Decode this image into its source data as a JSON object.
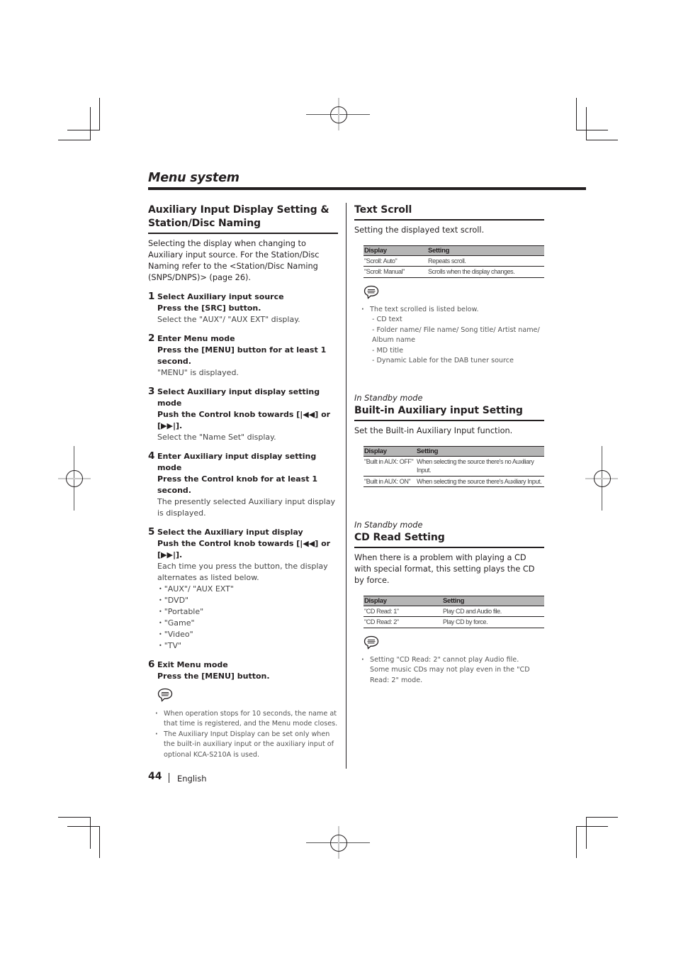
{
  "page": {
    "title": "Menu system",
    "page_number": "44",
    "language": "English"
  },
  "left": {
    "heading_line1": "Auxiliary Input Display Setting &",
    "heading_line2": "Station/Disc Naming",
    "intro": "Selecting the display when changing to Auxiliary input source. For the Station/Disc Naming refer to the <Station/Disc Naming (SNPS/DNPS)> (page 26).",
    "steps": [
      {
        "num": "1",
        "title": "Select Auxiliary input source",
        "action": "Press the [SRC] button.",
        "note": "Select the \"AUX\"/ \"AUX EXT\" display."
      },
      {
        "num": "2",
        "title": "Enter Menu mode",
        "action": "Press the [MENU] button for at least 1 second.",
        "note": "\"MENU\" is displayed."
      },
      {
        "num": "3",
        "title": "Select Auxiliary input display setting mode",
        "action": "Push the Control knob towards [|◀◀] or [▶▶|].",
        "note": "Select the \"Name Set\" display."
      },
      {
        "num": "4",
        "title": "Enter Auxiliary input display setting mode",
        "action": "Press the Control knob for at least 1 second.",
        "note": "The presently selected Auxiliary input display is displayed."
      },
      {
        "num": "5",
        "title": "Select the Auxiliary input display",
        "action": "Push the Control knob towards [|◀◀] or [▶▶|].",
        "note": "Each time you press the button, the display alternates as listed below."
      },
      {
        "num": "6",
        "title": "Exit Menu mode",
        "action": "Press the [MENU] button.",
        "note": ""
      }
    ],
    "options": [
      "\"AUX\"/ \"AUX EXT\"",
      "\"DVD\"",
      "\"Portable\"",
      "\"Game\"",
      "\"Video\"",
      "\"TV\""
    ],
    "note_icon": "note-speech-bubble-icon",
    "notes": [
      "When operation stops for 10 seconds, the name at that time is registered, and the Menu mode closes.",
      "The Auxiliary Input Display can be set only when the built-in auxiliary input or the auxiliary input of optional KCA-S210A is used."
    ]
  },
  "right": {
    "text_scroll": {
      "heading": "Text Scroll",
      "intro": "Setting the displayed text scroll.",
      "table": {
        "headers": [
          "Display",
          "Setting"
        ],
        "rows": [
          [
            "\"Scroll: Auto\"",
            "Repeats scroll."
          ],
          [
            "\"Scroll: Manual\"",
            "Scrolls when the display changes."
          ]
        ]
      },
      "note_main": "The text scrolled is listed below.",
      "note_sub": [
        "- CD text",
        "- Folder name/ File name/ Song title/ Artist name/ Album name",
        "- MD title",
        "- Dynamic Lable for the DAB tuner source"
      ]
    },
    "builtin_aux": {
      "mode": "In Standby mode",
      "heading": "Built-in Auxiliary input Setting",
      "intro": "Set the Built-in Auxiliary Input function.",
      "table": {
        "headers": [
          "Display",
          "Setting"
        ],
        "rows": [
          [
            "\"Built in AUX: OFF\"",
            "When selecting the source there's no Auxiliary Input."
          ],
          [
            "\"Built in AUX: ON\"",
            "When selecting the source there's Auxiliary Input."
          ]
        ]
      }
    },
    "cd_read": {
      "mode": "In Standby mode",
      "heading": "CD Read Setting",
      "intro": "When there is a problem with playing a CD with special format, this setting plays the CD by force.",
      "table": {
        "headers": [
          "Display",
          "Setting"
        ],
        "rows": [
          [
            "\"CD Read: 1\"",
            "Play CD and Audio file."
          ],
          [
            "\"CD Read: 2\"",
            "Play CD by force."
          ]
        ]
      },
      "note_line1": "Setting \"CD Read: 2\" cannot play Audio file.",
      "note_line2": "Some music CDs may not play even in the \"CD Read: 2\" mode."
    }
  }
}
